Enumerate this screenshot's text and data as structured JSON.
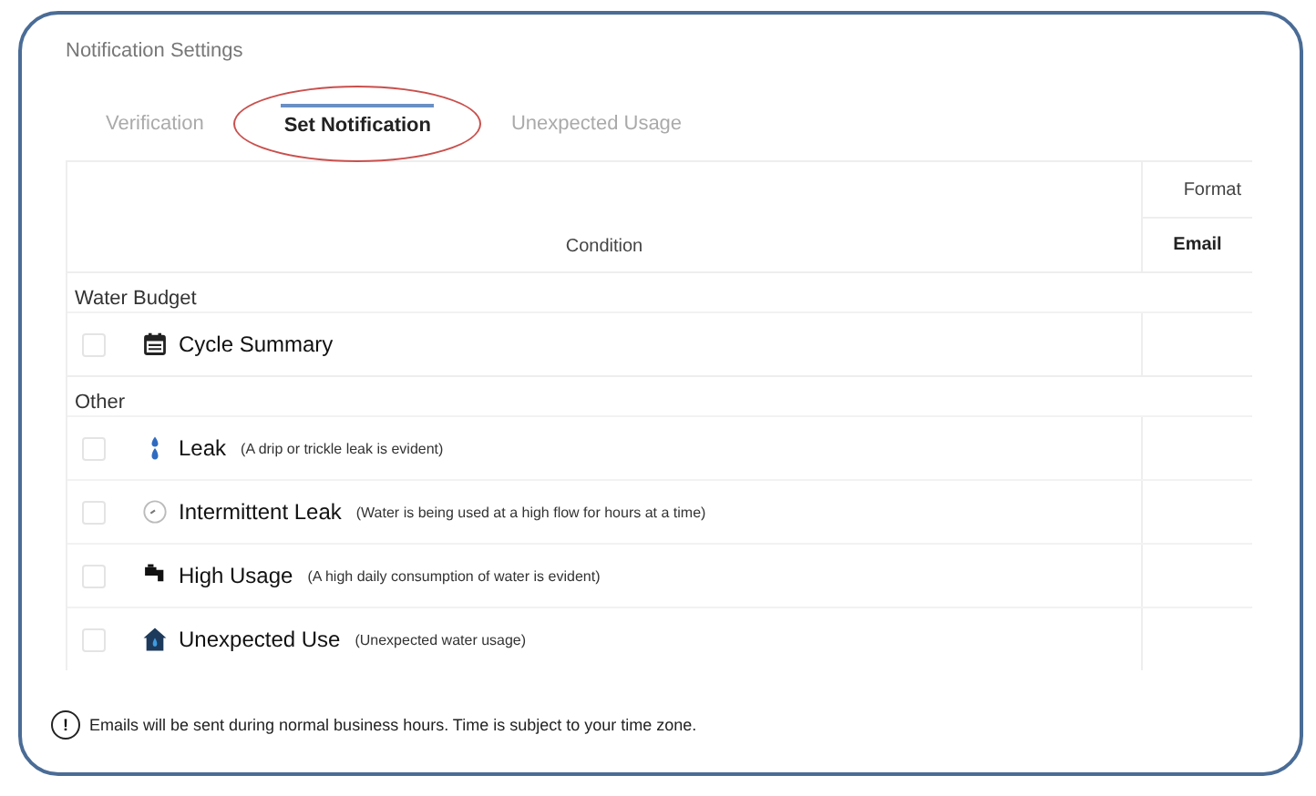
{
  "panel": {
    "title": "Notification Settings"
  },
  "tabs": [
    {
      "label": "Verification",
      "selected": false,
      "circled": false
    },
    {
      "label": "Set Notification",
      "selected": true,
      "circled": true
    },
    {
      "label": "Unexpected Usage",
      "selected": false,
      "circled": false
    }
  ],
  "table": {
    "columns": [
      {
        "label": "Condition"
      },
      {
        "group": "Format",
        "label": "Email"
      }
    ],
    "sections": [
      {
        "title": "Water Budget",
        "rows": [
          {
            "name": "Cycle Summary",
            "note": "",
            "checked": false
          }
        ]
      },
      {
        "title": "Other",
        "rows": [
          {
            "name": "Leak",
            "note": "(A drip or trickle leak is evident)",
            "checked": false
          },
          {
            "name": "Intermittent Leak",
            "note": "(Water is being used at a high flow for hours at a time)",
            "checked": false
          },
          {
            "name": "High Usage",
            "note": "(A high daily consumption of water is evident)",
            "checked": false
          },
          {
            "name": "Unexpected Use",
            "note": "(Unexpected water usage)",
            "checked": false
          }
        ]
      }
    ]
  },
  "footer": {
    "text": "Emails will be sent during normal business hours. Time is subject to your time zone.",
    "icon": "!"
  }
}
